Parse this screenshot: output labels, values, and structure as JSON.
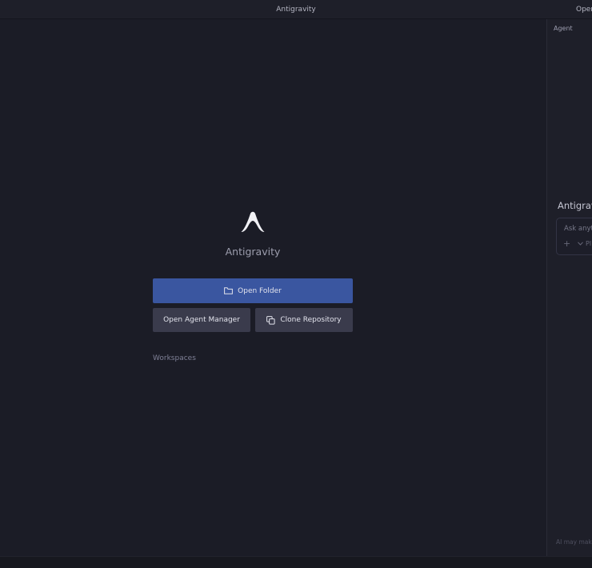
{
  "titlebar": {
    "title": "Antigravity",
    "right_text": "Open"
  },
  "main": {
    "logo": "antigravity-logo",
    "app_name": "Antigravity",
    "open_folder_label": "Open Folder",
    "open_folder_icon": "folder-icon",
    "open_agent_manager_label": "Open Agent Manager",
    "clone_repository_label": "Clone Repository",
    "clone_icon": "copy-icon",
    "workspaces_heading": "Workspaces"
  },
  "sidebar": {
    "panel_label": "Agent",
    "brand_title": "Antigrav",
    "input_placeholder": "Ask anyth",
    "add_icon": "plus-icon",
    "mode_label": "Pl",
    "disclaimer": "AI may make"
  },
  "colors": {
    "background": "#1b1c26",
    "primary_button": "#3a56a0",
    "secondary_button": "#3a3b4c"
  }
}
